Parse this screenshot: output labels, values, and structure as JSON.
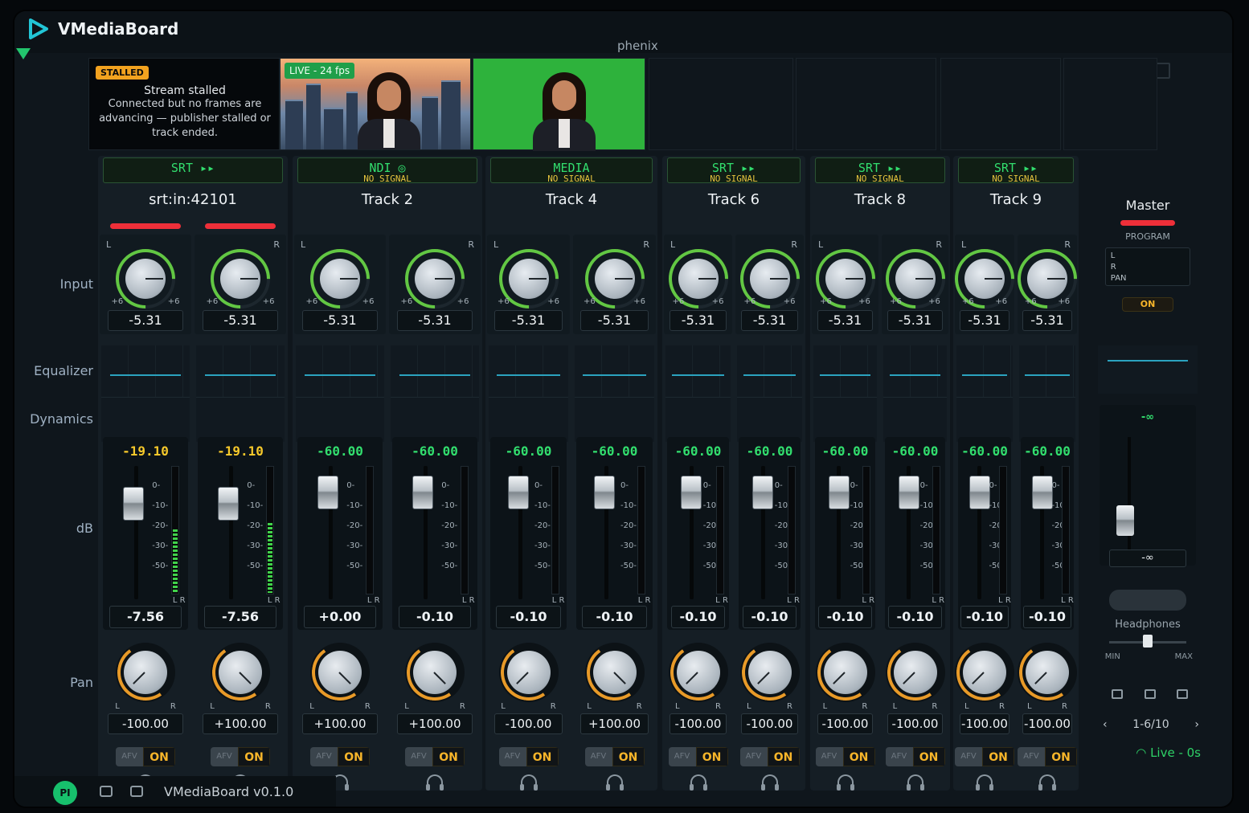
{
  "app": {
    "name": "VMediaBoard",
    "window_title": "phenix",
    "version": "VMediaBoard v0.1.0",
    "user_initials": "PI"
  },
  "sections": {
    "input": "Input",
    "equalizer": "Equalizer",
    "dynamics": "Dynamics",
    "db": "dB",
    "pan": "Pan"
  },
  "preview1": {
    "badge": "STALLED",
    "title": "Stream stalled",
    "body": "Connected but no frames are advancing — publisher stalled or track ended."
  },
  "preview2": {
    "badge": "LIVE - 24 fps"
  },
  "scale": [
    "0-",
    "-10-",
    "-20-",
    "-30-",
    "-50-"
  ],
  "afv_label": "AFV",
  "on_label": "ON",
  "six": "+6",
  "L": "L",
  "R": "R",
  "channels": [
    {
      "source": "SRT ▸▸",
      "status": "",
      "name": "srt:in:42101",
      "peak": [
        "-19.10",
        "-19.10"
      ],
      "input": [
        "-5.31",
        "-5.31"
      ],
      "db": [
        "-7.56",
        "-7.56"
      ],
      "pan": [
        "-100.00",
        "+100.00"
      ],
      "peak_color": "#f7c92b",
      "meter": [
        0.5,
        0.55
      ]
    },
    {
      "source": "NDI ◎",
      "status": "NO SIGNAL",
      "name": "Track 2",
      "peak": [
        "-60.00",
        "-60.00"
      ],
      "input": [
        "-5.31",
        "-5.31"
      ],
      "db": [
        "+0.00",
        "-0.10"
      ],
      "pan": [
        "+100.00",
        "+100.00"
      ],
      "peak_color": "#32de6e",
      "meter": [
        0,
        0
      ]
    },
    {
      "source": "MEDIA",
      "status": "NO SIGNAL",
      "name": "Track 4",
      "peak": [
        "-60.00",
        "-60.00"
      ],
      "input": [
        "-5.31",
        "-5.31"
      ],
      "db": [
        "-0.10",
        "-0.10"
      ],
      "pan": [
        "-100.00",
        "+100.00"
      ],
      "peak_color": "#32de6e",
      "meter": [
        0,
        0
      ]
    },
    {
      "source": "SRT ▸▸",
      "status": "NO SIGNAL",
      "name": "Track 6",
      "peak": [
        "-60.00",
        "-60.00"
      ],
      "input": [
        "-5.31",
        "-5.31"
      ],
      "db": [
        "-0.10",
        "-0.10"
      ],
      "pan": [
        "-100.00",
        "-100.00"
      ],
      "peak_color": "#32de6e",
      "meter": [
        0,
        0
      ]
    },
    {
      "source": "SRT ▸▸",
      "status": "NO SIGNAL",
      "name": "Track 8",
      "peak": [
        "-60.00",
        "-60.00"
      ],
      "input": [
        "-5.31",
        "-5.31"
      ],
      "db": [
        "-0.10",
        "-0.10"
      ],
      "pan": [
        "-100.00",
        "-100.00"
      ],
      "peak_color": "#32de6e",
      "meter": [
        0,
        0
      ]
    },
    {
      "source": "SRT ▸▸",
      "status": "NO SIGNAL",
      "name": "Track 9",
      "peak": [
        "-60.00",
        "-60.00"
      ],
      "input": [
        "-5.31",
        "-5.31"
      ],
      "db": [
        "-0.10",
        "-0.10"
      ],
      "pan": [
        "-100.00",
        "-100.00"
      ],
      "peak_color": "#32de6e",
      "meter": [
        0,
        0
      ]
    }
  ],
  "master": {
    "name": "Master",
    "program": "PROGRAM",
    "box_l": "L",
    "box_r": "R",
    "box_pan": "PAN",
    "on": "ON",
    "peak": "-∞",
    "db": "-∞",
    "headphones": "Headphones",
    "min": "MIN",
    "max": "MAX",
    "page": "1-6/10",
    "live": "Live - 0s"
  }
}
